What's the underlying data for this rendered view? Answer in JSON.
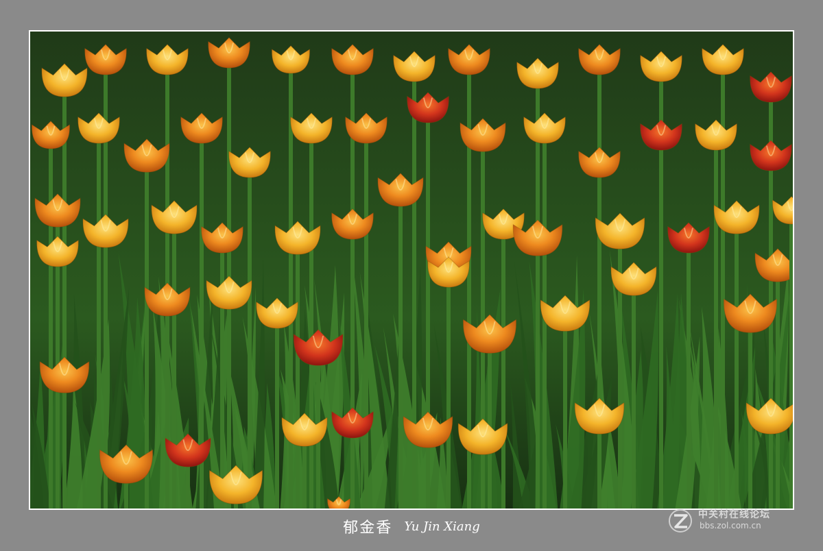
{
  "caption": {
    "chinese": "郁金香",
    "latin": "Yu Jin Xiang"
  },
  "watermark": {
    "site_name": "中关村在线论坛",
    "url": "bbs.zol.com.cn"
  },
  "colors": {
    "frame": "#8a8a8a",
    "border": "#ffffff",
    "leaf_dark": "#1d3a17",
    "leaf": "#2f6a22",
    "tulip_yellow": "#f2b32a",
    "tulip_orange": "#ec8a1e",
    "tulip_red": "#c9281c"
  }
}
